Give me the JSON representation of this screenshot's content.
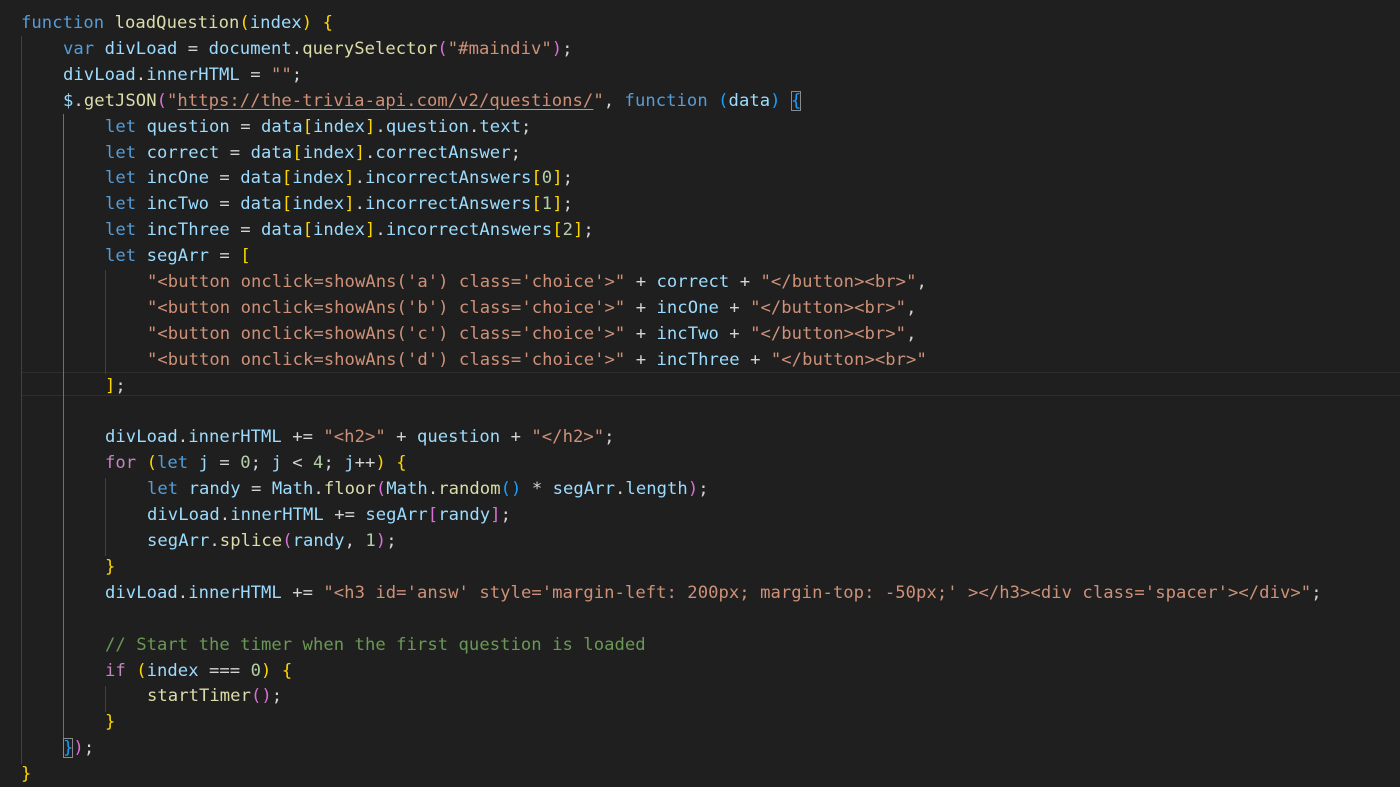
{
  "editor": {
    "language": "javascript",
    "colors": {
      "background": "#1f1f1f",
      "keyword": "#569cd6",
      "control": "#c586c0",
      "function": "#dcdcaa",
      "variable": "#9cdcfe",
      "string": "#ce9178",
      "number": "#b5cea8",
      "comment": "#6a9955",
      "punctuation": "#d4d4d4",
      "bracket1": "#ffd700",
      "bracket2": "#da70d6",
      "bracket3": "#179fff",
      "object": "#4ec9b0"
    },
    "lines": [
      {
        "indent": 0,
        "tokens": [
          [
            "function",
            "kw"
          ],
          [
            " ",
            "p"
          ],
          [
            "loadQuestion",
            "fn"
          ],
          [
            "(",
            "b1"
          ],
          [
            "index",
            "v"
          ],
          [
            ")",
            "b1"
          ],
          [
            " ",
            "p"
          ],
          [
            "{",
            "b1"
          ]
        ]
      },
      {
        "indent": 1,
        "tokens": [
          [
            "var",
            "kw"
          ],
          [
            " ",
            "p"
          ],
          [
            "divLoad",
            "v"
          ],
          [
            " = ",
            "p"
          ],
          [
            "document",
            "v"
          ],
          [
            ".",
            "p"
          ],
          [
            "querySelector",
            "fn"
          ],
          [
            "(",
            "b2"
          ],
          [
            "\"#maindiv\"",
            "s"
          ],
          [
            ")",
            "b2"
          ],
          [
            ";",
            "p"
          ]
        ]
      },
      {
        "indent": 1,
        "tokens": [
          [
            "divLoad",
            "v"
          ],
          [
            ".",
            "p"
          ],
          [
            "innerHTML",
            "v"
          ],
          [
            " = ",
            "p"
          ],
          [
            "\"\"",
            "s"
          ],
          [
            ";",
            "p"
          ]
        ]
      },
      {
        "indent": 1,
        "tokens": [
          [
            "$",
            "v"
          ],
          [
            ".",
            "p"
          ],
          [
            "getJSON",
            "fn"
          ],
          [
            "(",
            "b2"
          ],
          [
            "\"",
            "s"
          ],
          [
            "https://the-trivia-api.com/v2/questions/",
            "url"
          ],
          [
            "\"",
            "s"
          ],
          [
            ", ",
            "p"
          ],
          [
            "function",
            "kw"
          ],
          [
            " ",
            "p"
          ],
          [
            "(",
            "b3"
          ],
          [
            "data",
            "v"
          ],
          [
            ")",
            "b3"
          ],
          [
            " ",
            "p"
          ],
          [
            "{",
            "b3m"
          ]
        ]
      },
      {
        "indent": 2,
        "tokens": [
          [
            "let",
            "kw"
          ],
          [
            " ",
            "p"
          ],
          [
            "question",
            "v"
          ],
          [
            " = ",
            "p"
          ],
          [
            "data",
            "v"
          ],
          [
            "[",
            "b1"
          ],
          [
            "index",
            "v"
          ],
          [
            "]",
            "b1"
          ],
          [
            ".",
            "p"
          ],
          [
            "question",
            "v"
          ],
          [
            ".",
            "p"
          ],
          [
            "text",
            "v"
          ],
          [
            ";",
            "p"
          ]
        ]
      },
      {
        "indent": 2,
        "tokens": [
          [
            "let",
            "kw"
          ],
          [
            " ",
            "p"
          ],
          [
            "correct",
            "v"
          ],
          [
            " = ",
            "p"
          ],
          [
            "data",
            "v"
          ],
          [
            "[",
            "b1"
          ],
          [
            "index",
            "v"
          ],
          [
            "]",
            "b1"
          ],
          [
            ".",
            "p"
          ],
          [
            "correctAnswer",
            "v"
          ],
          [
            ";",
            "p"
          ]
        ]
      },
      {
        "indent": 2,
        "tokens": [
          [
            "let",
            "kw"
          ],
          [
            " ",
            "p"
          ],
          [
            "incOne",
            "v"
          ],
          [
            " = ",
            "p"
          ],
          [
            "data",
            "v"
          ],
          [
            "[",
            "b1"
          ],
          [
            "index",
            "v"
          ],
          [
            "]",
            "b1"
          ],
          [
            ".",
            "p"
          ],
          [
            "incorrectAnswers",
            "v"
          ],
          [
            "[",
            "b1"
          ],
          [
            "0",
            "n"
          ],
          [
            "]",
            "b1"
          ],
          [
            ";",
            "p"
          ]
        ]
      },
      {
        "indent": 2,
        "tokens": [
          [
            "let",
            "kw"
          ],
          [
            " ",
            "p"
          ],
          [
            "incTwo",
            "v"
          ],
          [
            " = ",
            "p"
          ],
          [
            "data",
            "v"
          ],
          [
            "[",
            "b1"
          ],
          [
            "index",
            "v"
          ],
          [
            "]",
            "b1"
          ],
          [
            ".",
            "p"
          ],
          [
            "incorrectAnswers",
            "v"
          ],
          [
            "[",
            "b1"
          ],
          [
            "1",
            "n"
          ],
          [
            "]",
            "b1"
          ],
          [
            ";",
            "p"
          ]
        ]
      },
      {
        "indent": 2,
        "tokens": [
          [
            "let",
            "kw"
          ],
          [
            " ",
            "p"
          ],
          [
            "incThree",
            "v"
          ],
          [
            " = ",
            "p"
          ],
          [
            "data",
            "v"
          ],
          [
            "[",
            "b1"
          ],
          [
            "index",
            "v"
          ],
          [
            "]",
            "b1"
          ],
          [
            ".",
            "p"
          ],
          [
            "incorrectAnswers",
            "v"
          ],
          [
            "[",
            "b1"
          ],
          [
            "2",
            "n"
          ],
          [
            "]",
            "b1"
          ],
          [
            ";",
            "p"
          ]
        ]
      },
      {
        "indent": 2,
        "tokens": [
          [
            "let",
            "kw"
          ],
          [
            " ",
            "p"
          ],
          [
            "segArr",
            "v"
          ],
          [
            " = ",
            "p"
          ],
          [
            "[",
            "b1"
          ]
        ]
      },
      {
        "indent": 3,
        "tokens": [
          [
            "\"<button onclick=showAns('a') class='choice'>\"",
            "s"
          ],
          [
            " + ",
            "p"
          ],
          [
            "correct",
            "v"
          ],
          [
            " + ",
            "p"
          ],
          [
            "\"</button><br>\"",
            "s"
          ],
          [
            ",",
            "p"
          ]
        ]
      },
      {
        "indent": 3,
        "tokens": [
          [
            "\"<button onclick=showAns('b') class='choice'>\"",
            "s"
          ],
          [
            " + ",
            "p"
          ],
          [
            "incOne",
            "v"
          ],
          [
            " + ",
            "p"
          ],
          [
            "\"</button><br>\"",
            "s"
          ],
          [
            ",",
            "p"
          ]
        ]
      },
      {
        "indent": 3,
        "tokens": [
          [
            "\"<button onclick=showAns('c') class='choice'>\"",
            "s"
          ],
          [
            " + ",
            "p"
          ],
          [
            "incTwo",
            "v"
          ],
          [
            " + ",
            "p"
          ],
          [
            "\"</button><br>\"",
            "s"
          ],
          [
            ",",
            "p"
          ]
        ]
      },
      {
        "indent": 3,
        "tokens": [
          [
            "\"<button onclick=showAns('d') class='choice'>\"",
            "s"
          ],
          [
            " + ",
            "p"
          ],
          [
            "incThree",
            "v"
          ],
          [
            " + ",
            "p"
          ],
          [
            "\"</button><br>\"",
            "s"
          ]
        ]
      },
      {
        "indent": 2,
        "tokens": [
          [
            "]",
            "b1"
          ],
          [
            ";",
            "p"
          ]
        ]
      },
      {
        "indent": 0,
        "tokens": []
      },
      {
        "indent": 2,
        "tokens": [
          [
            "divLoad",
            "v"
          ],
          [
            ".",
            "p"
          ],
          [
            "innerHTML",
            "v"
          ],
          [
            " += ",
            "p"
          ],
          [
            "\"<h2>\"",
            "s"
          ],
          [
            " + ",
            "p"
          ],
          [
            "question",
            "v"
          ],
          [
            " + ",
            "p"
          ],
          [
            "\"</h2>\"",
            "s"
          ],
          [
            ";",
            "p"
          ]
        ]
      },
      {
        "indent": 2,
        "tokens": [
          [
            "for",
            "ctl"
          ],
          [
            " ",
            "p"
          ],
          [
            "(",
            "b1"
          ],
          [
            "let",
            "kw"
          ],
          [
            " ",
            "p"
          ],
          [
            "j",
            "v"
          ],
          [
            " = ",
            "p"
          ],
          [
            "0",
            "n"
          ],
          [
            "; ",
            "p"
          ],
          [
            "j",
            "v"
          ],
          [
            " < ",
            "p"
          ],
          [
            "4",
            "n"
          ],
          [
            "; ",
            "p"
          ],
          [
            "j",
            "v"
          ],
          [
            "++",
            "p"
          ],
          [
            ")",
            "b1"
          ],
          [
            " ",
            "p"
          ],
          [
            "{",
            "b1"
          ]
        ]
      },
      {
        "indent": 3,
        "tokens": [
          [
            "let",
            "kw"
          ],
          [
            " ",
            "p"
          ],
          [
            "randy",
            "v"
          ],
          [
            " = ",
            "p"
          ],
          [
            "Math",
            "v"
          ],
          [
            ".",
            "p"
          ],
          [
            "floor",
            "fn"
          ],
          [
            "(",
            "b2"
          ],
          [
            "Math",
            "v"
          ],
          [
            ".",
            "p"
          ],
          [
            "random",
            "fn"
          ],
          [
            "(",
            "b3"
          ],
          [
            ")",
            "b3"
          ],
          [
            " * ",
            "p"
          ],
          [
            "segArr",
            "v"
          ],
          [
            ".",
            "p"
          ],
          [
            "length",
            "v"
          ],
          [
            ")",
            "b2"
          ],
          [
            ";",
            "p"
          ]
        ]
      },
      {
        "indent": 3,
        "tokens": [
          [
            "divLoad",
            "v"
          ],
          [
            ".",
            "p"
          ],
          [
            "innerHTML",
            "v"
          ],
          [
            " += ",
            "p"
          ],
          [
            "segArr",
            "v"
          ],
          [
            "[",
            "b2"
          ],
          [
            "randy",
            "v"
          ],
          [
            "]",
            "b2"
          ],
          [
            ";",
            "p"
          ]
        ]
      },
      {
        "indent": 3,
        "tokens": [
          [
            "segArr",
            "v"
          ],
          [
            ".",
            "p"
          ],
          [
            "splice",
            "fn"
          ],
          [
            "(",
            "b2"
          ],
          [
            "randy",
            "v"
          ],
          [
            ", ",
            "p"
          ],
          [
            "1",
            "n"
          ],
          [
            ")",
            "b2"
          ],
          [
            ";",
            "p"
          ]
        ]
      },
      {
        "indent": 2,
        "tokens": [
          [
            "}",
            "b1"
          ]
        ]
      },
      {
        "indent": 2,
        "tokens": [
          [
            "divLoad",
            "v"
          ],
          [
            ".",
            "p"
          ],
          [
            "innerHTML",
            "v"
          ],
          [
            " += ",
            "p"
          ],
          [
            "\"<h3 id='answ' style='margin-left: 200px; margin-top: -50px;' ></h3><div class='spacer'></div>\"",
            "s"
          ],
          [
            ";",
            "p"
          ]
        ]
      },
      {
        "indent": 0,
        "tokens": []
      },
      {
        "indent": 2,
        "tokens": [
          [
            "// Start the timer when the first question is loaded",
            "c"
          ]
        ]
      },
      {
        "indent": 2,
        "tokens": [
          [
            "if",
            "ctl"
          ],
          [
            " ",
            "p"
          ],
          [
            "(",
            "b1"
          ],
          [
            "index",
            "v"
          ],
          [
            " === ",
            "p"
          ],
          [
            "0",
            "n"
          ],
          [
            ")",
            "b1"
          ],
          [
            " ",
            "p"
          ],
          [
            "{",
            "b1"
          ]
        ]
      },
      {
        "indent": 3,
        "tokens": [
          [
            "startTimer",
            "fn"
          ],
          [
            "(",
            "b2"
          ],
          [
            ")",
            "b2"
          ],
          [
            ";",
            "p"
          ]
        ]
      },
      {
        "indent": 2,
        "tokens": [
          [
            "}",
            "b1"
          ]
        ]
      },
      {
        "indent": 1,
        "tokens": [
          [
            "}",
            "b3m"
          ],
          [
            ")",
            "b2"
          ],
          [
            ";",
            "p"
          ]
        ]
      },
      {
        "indent": 0,
        "tokens": [
          [
            "}",
            "b1"
          ]
        ]
      }
    ]
  }
}
